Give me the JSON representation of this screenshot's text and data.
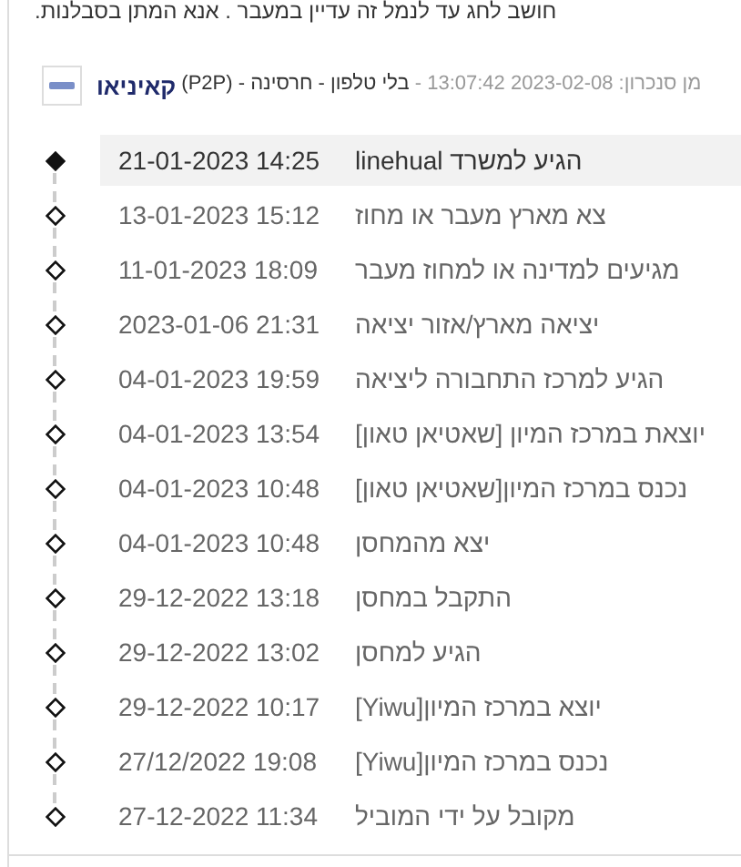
{
  "notice": "חושב לחג עד לנמל זה עדיין במעבר . אנא המתן בסבלנות.",
  "shipment": {
    "carrier": "קאיניאו",
    "details": " בלי טלפון - חרסינה - (P2P) ",
    "sync": "מן סנכרון: 2023-02-08 13:07:42 -"
  },
  "events": [
    {
      "time": "21-01-2023 14:25",
      "status": "הגיע למשרד linehual",
      "current": true
    },
    {
      "time": "13-01-2023 15:12",
      "status": "צא מארץ מעבר או מחוז",
      "current": false
    },
    {
      "time": "11-01-2023 18:09",
      "status": "מגיעים למדינה או למחוז מעבר",
      "current": false
    },
    {
      "time": "2023-01-06 21:31",
      "status": "יציאה מארץ/אזור יציאה",
      "current": false
    },
    {
      "time": "04-01-2023 19:59",
      "status": "הגיע למרכז התחבורה ליציאה",
      "current": false
    },
    {
      "time": "04-01-2023 13:54",
      "status": "יוצאת במרכז המיון [שאטיאן טאון]",
      "current": false
    },
    {
      "time": "04-01-2023 10:48",
      "status": "נכנס במרכז המיון[שאטיאן טאון]",
      "current": false
    },
    {
      "time": "04-01-2023 10:48",
      "status": "יצא מהמחסן",
      "current": false
    },
    {
      "time": "29-12-2022 13:18",
      "status": "התקבל במחסן",
      "current": false
    },
    {
      "time": "29-12-2022 13:02",
      "status": "הגיע למחסן",
      "current": false
    },
    {
      "time": "29-12-2022 10:17",
      "status": "יוצא במרכז המיון[Yiwu]",
      "current": false
    },
    {
      "time": "27/12/2022 19:08",
      "status": "נכנס במרכז המיון[Yiwu]",
      "current": false
    },
    {
      "time": "27-12-2022 11:34",
      "status": "מקובל על ידי המוביל",
      "current": false
    }
  ]
}
